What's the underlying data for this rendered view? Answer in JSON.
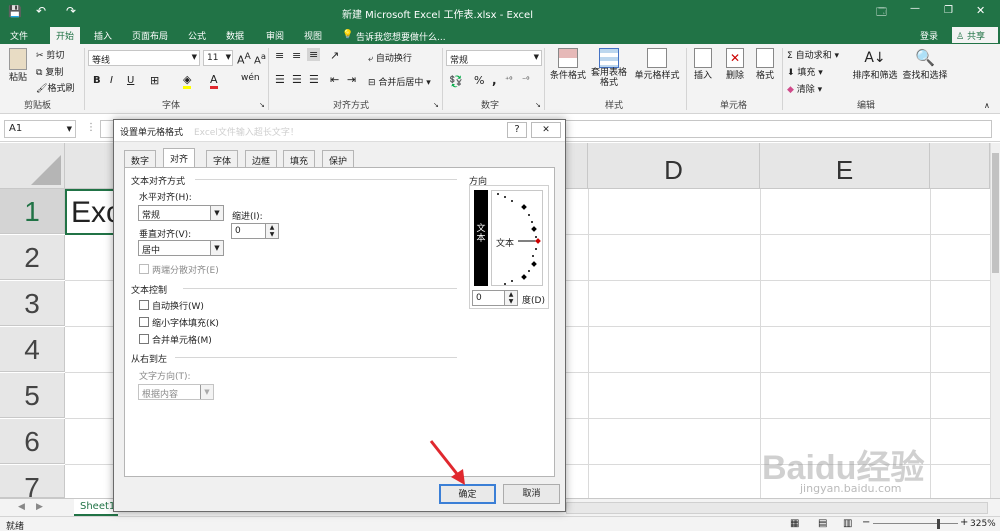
{
  "window": {
    "title": "新建 Microsoft Excel 工作表.xlsx - Excel",
    "minimize": "🗔",
    "restore": "—",
    "close": "✕"
  },
  "menu": {
    "tabs": [
      "文件",
      "开始",
      "插入",
      "页面布局",
      "公式",
      "数据",
      "审阅",
      "视图"
    ],
    "tellme": "告诉我您想要做什么...",
    "login": "登录",
    "share": "共享"
  },
  "ribbon": {
    "clipboard": {
      "paste": "粘贴",
      "cut": "剪切",
      "copy": "复制",
      "painter": "格式刷",
      "label": "剪贴板"
    },
    "font": {
      "name": "等线",
      "size": "11",
      "bold": "B",
      "italic": "I",
      "underline": "U",
      "label": "字体",
      "phonetic": "wén"
    },
    "align": {
      "wrap": "自动换行",
      "merge": "合并后居中",
      "label": "对齐方式"
    },
    "number": {
      "format": "常规",
      "percent": "%",
      "comma": ",",
      "label": "数字"
    },
    "styles": {
      "cond": "条件格式",
      "table": "套用表格格式",
      "cell": "单元格样式",
      "label": "样式"
    },
    "cells": {
      "insert": "插入",
      "delete": "删除",
      "format": "格式",
      "label": "单元格"
    },
    "editing": {
      "autosum": "自动求和",
      "fill": "填充",
      "clear": "清除",
      "sort": "排序和筛选",
      "find": "查找和选择",
      "label": "编辑"
    }
  },
  "formula": {
    "namebox": "A1",
    "faded": "Excel文件输入超长文字！"
  },
  "sheet": {
    "cols": [
      "D",
      "E"
    ],
    "rows": [
      "1",
      "2",
      "3",
      "4",
      "5",
      "6",
      "7"
    ],
    "a1": "Exc"
  },
  "tabs": {
    "sheet1": "Sheet1"
  },
  "status": {
    "ready": "就绪",
    "zoom": "325%",
    "minus": "−",
    "plus": "+"
  },
  "dialog": {
    "title": "设置单元格格式",
    "title_faded": "Excel文件输入超长文字！",
    "help": "?",
    "close": "✕",
    "tabs": [
      "数字",
      "对齐",
      "字体",
      "边框",
      "填充",
      "保护"
    ],
    "text_align_group": "文本对齐方式",
    "h_align_label": "水平对齐(H):",
    "h_align_value": "常规",
    "indent_label": "缩进(I):",
    "indent_value": "0",
    "v_align_label": "垂直对齐(V):",
    "v_align_value": "居中",
    "distributed": "两端分散对齐(E)",
    "text_control_group": "文本控制",
    "wrap": "自动换行(W)",
    "shrink": "缩小字体填充(K)",
    "merge": "合并单元格(M)",
    "rtl_group": "从右到左",
    "direction_label": "文字方向(T):",
    "direction_value": "根据内容",
    "orientation_group": "方向",
    "vertical_text": "文本",
    "rotated_text": "文本",
    "degrees_value": "0",
    "degrees_label": "度(D)",
    "ok": "确定",
    "cancel": "取消"
  },
  "watermark": {
    "brand": "Baidu经验",
    "url": "jingyan.baidu.com"
  },
  "colors": {
    "excel_green": "#217346",
    "ok_border": "#3b7fd6",
    "arrow_red": "#e0282e"
  }
}
